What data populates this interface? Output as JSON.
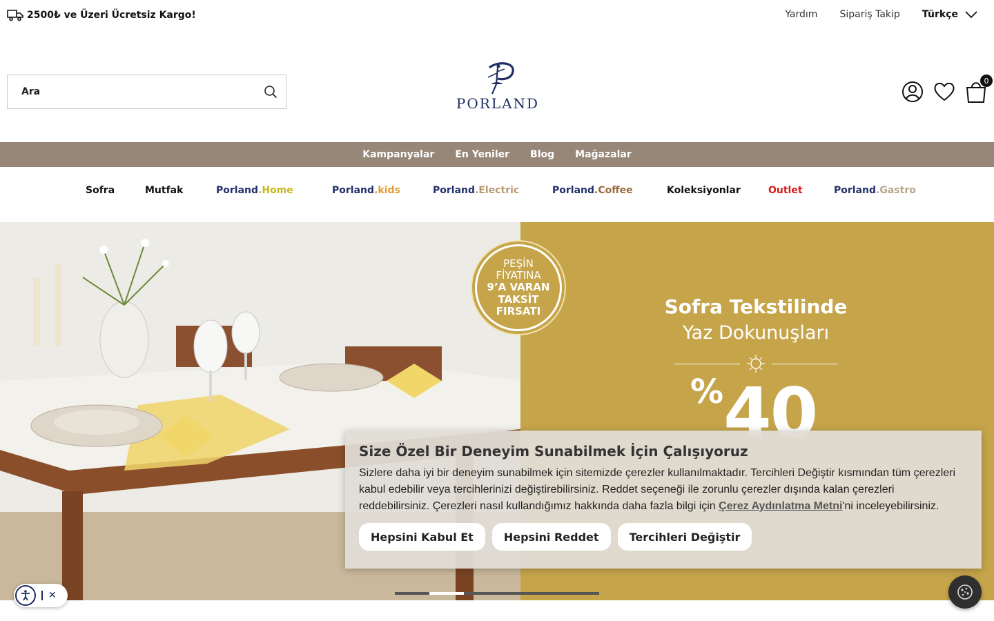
{
  "topbar": {
    "shipping_text": "2500₺ ve Üzeri Ücretsiz Kargo!",
    "help": "Yardım",
    "order_tracking": "Sipariş Takip",
    "language": "Türkçe"
  },
  "header": {
    "search_placeholder": "Ara",
    "logo_text": "PORLAND",
    "cart_count": "0"
  },
  "strip_nav": [
    "Kampanyalar",
    "En Yeniler",
    "Blog",
    "Mağazalar"
  ],
  "categories": {
    "sofra": "Sofra",
    "mutfak": "Mutfak",
    "home": {
      "brand": "Porland",
      "suffix": ".Home",
      "color": "#c9b81e"
    },
    "kids": {
      "brand": "Porland",
      "suffix": ".kids",
      "color": "#e39a2d"
    },
    "electric": {
      "brand": "Porland",
      "suffix": ".Electric",
      "color": "#b79b72"
    },
    "coffee": {
      "brand": "Porland",
      "suffix": ".Coffee",
      "color": "#9b6a3a"
    },
    "koleksiyonlar": "Koleksiyonlar",
    "outlet": "Outlet",
    "gastro": {
      "brand": "Porland",
      "suffix": ".Gastro",
      "color": "#b8a58c"
    }
  },
  "hero": {
    "badge_line1": "PEŞİN",
    "badge_line2": "FİYATINA",
    "badge_line3": "9’A VARAN",
    "badge_line4": "TAKSİT",
    "badge_line5": "FIRSATI",
    "title": "Sofra Tekstilinde",
    "subtitle": "Yaz Dokunuşları",
    "percent_sign": "%",
    "percent_value": "40",
    "bg_color": "#c6a44a"
  },
  "cookie": {
    "title": "Size Özel Bir Deneyim Sunabilmek İçin Çalışıyoruz",
    "body_before": "Sizlere daha iyi bir deneyim sunabilmek için sitemizde çerezler kullanılmaktadır. Tercihleri Değiştir kısmından tüm çerezleri kabul edebilir veya tercihlerinizi değiştirebilirsiniz. Reddet seçeneği ile zorunlu çerezler dışında kalan çerezleri reddebilirsiniz. Çerezleri nasıl kullandığımız hakkında daha fazla bilgi için ",
    "link_text": "Çerez Aydınlatma Metni",
    "body_after": "'ni inceleyebilirsiniz.",
    "accept_all": "Hepsini Kabul Et",
    "reject_all": "Hepsini Reddet",
    "preferences": "Tercihleri Değiştir"
  },
  "widgets": {
    "accessibility_close": "✕"
  }
}
